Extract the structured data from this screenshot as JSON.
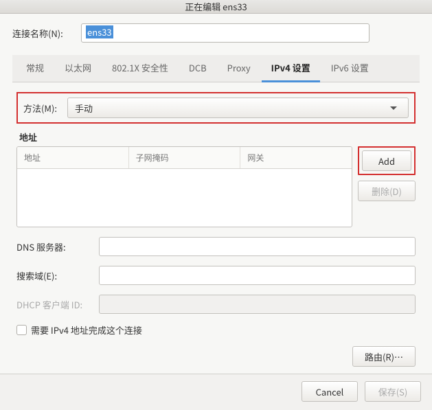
{
  "window": {
    "title": "正在编辑 ens33"
  },
  "connection": {
    "label": "连接名称(N):",
    "value": "ens33"
  },
  "tabs": {
    "general": "常规",
    "ethernet": "以太网",
    "dot1x": "802.1X 安全性",
    "dcb": "DCB",
    "proxy": "Proxy",
    "ipv4": "IPv4 设置",
    "ipv6": "IPv6 设置"
  },
  "method": {
    "label": "方法(M):",
    "value": "手动"
  },
  "addresses": {
    "section_label": "地址",
    "col_address": "地址",
    "col_netmask": "子网掩码",
    "col_gateway": "网关",
    "add_button": "Add",
    "delete_button": "删除(D)"
  },
  "fields": {
    "dns_label": "DNS 服务器:",
    "search_label": "搜索域(E):",
    "dhcp_label": "DHCP 客户端 ID:",
    "require_label": "需要 IPv4 地址完成这个连接"
  },
  "routes_button": "路由(R)…",
  "footer": {
    "cancel": "Cancel",
    "save": "保存(S)"
  }
}
